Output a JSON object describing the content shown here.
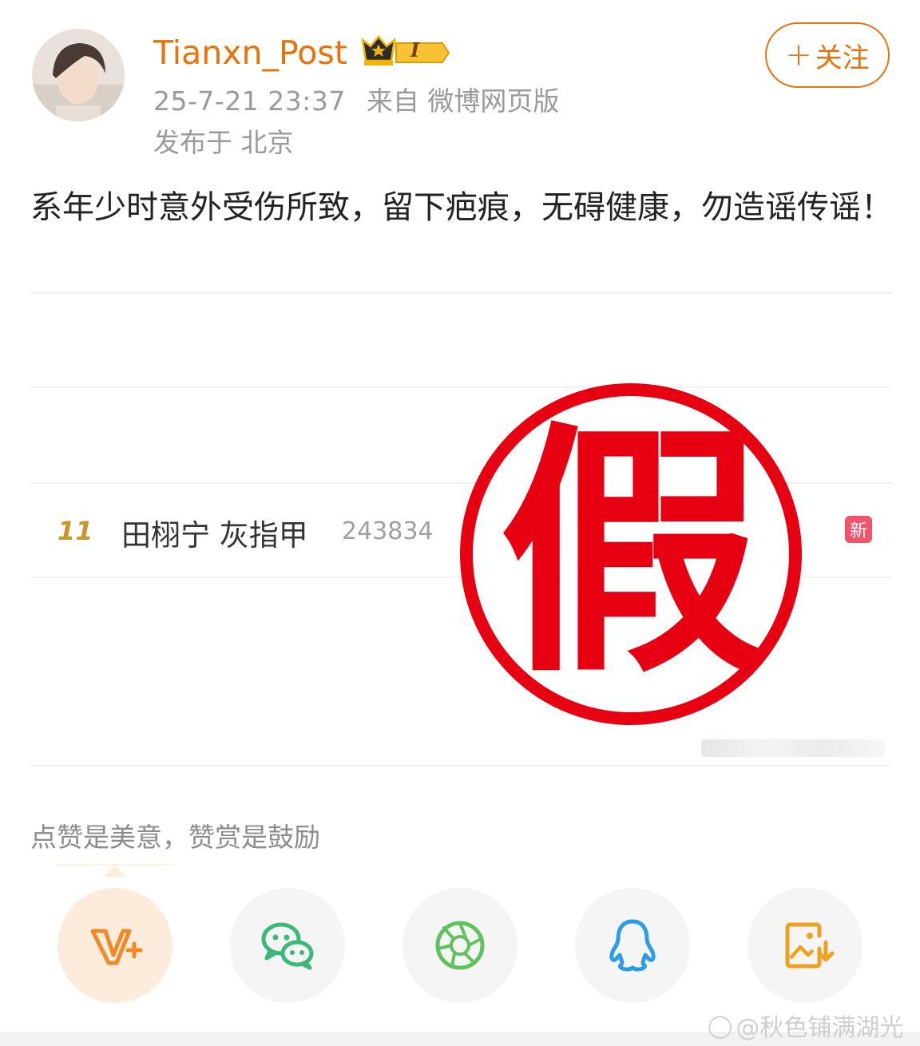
{
  "post": {
    "username": "Tianxn_Post",
    "badge_level": "I",
    "timestamp": "25-7-21 23:37",
    "source": "来自 微博网页版",
    "location": "发布于 北京",
    "follow_label": "关注",
    "text": "系年少时意外受伤所致，留下疤痕，无碍健康，勿造谣传谣！"
  },
  "image": {
    "trend": {
      "rank": "11",
      "title": "田栩宁 灰指甲",
      "count": "243834",
      "badge": "新"
    },
    "stamp_text": "假",
    "stamp_color": "#e60012"
  },
  "reward": {
    "text": "点赞是美意，赞赏是鼓励"
  },
  "share": {
    "items": [
      {
        "icon": "vplus-icon",
        "color": "#f08a24"
      },
      {
        "icon": "wechat-icon",
        "color": "#3cb878"
      },
      {
        "icon": "moments-icon",
        "color": "#5fc35d"
      },
      {
        "icon": "qq-icon",
        "color": "#2d9ce8"
      },
      {
        "icon": "save-image-icon",
        "color": "#f0a020"
      }
    ]
  },
  "watermark": "@秋色铺满湖光",
  "colors": {
    "accent": "#e8720c",
    "meta_gray": "#9a9a9a"
  }
}
